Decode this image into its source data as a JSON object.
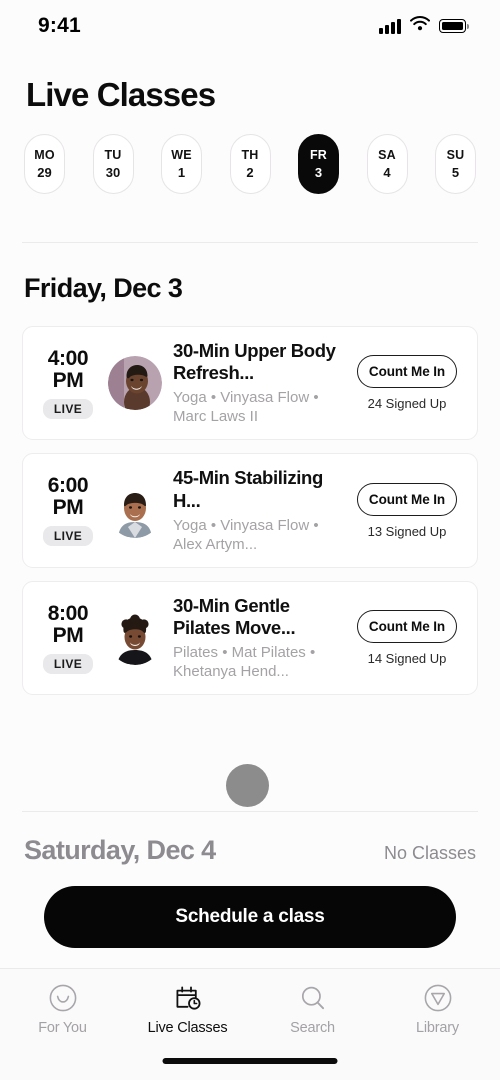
{
  "status_bar": {
    "time": "9:41",
    "icons": [
      "signal-bars-icon",
      "wifi-icon",
      "battery-icon"
    ]
  },
  "header": {
    "title": "Live Classes"
  },
  "day_strip": {
    "days": [
      {
        "dow": "MO",
        "date": "29",
        "selected": false
      },
      {
        "dow": "TU",
        "date": "30",
        "selected": false
      },
      {
        "dow": "WE",
        "date": "1",
        "selected": false
      },
      {
        "dow": "TH",
        "date": "2",
        "selected": false
      },
      {
        "dow": "FR",
        "date": "3",
        "selected": true
      },
      {
        "dow": "SA",
        "date": "4",
        "selected": false
      },
      {
        "dow": "SU",
        "date": "5",
        "selected": false
      }
    ]
  },
  "sections": {
    "today": {
      "title": "Friday, Dec 3",
      "classes": [
        {
          "time": "4:00 PM",
          "badge": "LIVE",
          "title": "30-Min Upper Body Refresh...",
          "meta": "Yoga • Vinyasa Flow • Marc Laws II",
          "action_label": "Count Me In",
          "signed_up": "24 Signed Up",
          "avatar_name": "instructor-avatar-marc-laws"
        },
        {
          "time": "6:00 PM",
          "badge": "LIVE",
          "title": "45-Min Stabilizing H...",
          "meta": "Yoga • Vinyasa Flow • Alex Artym...",
          "action_label": "Count Me In",
          "signed_up": "13 Signed Up",
          "avatar_name": "instructor-avatar-alex-artym"
        },
        {
          "time": "8:00 PM",
          "badge": "LIVE",
          "title": "30-Min Gentle Pilates Move...",
          "meta": "Pilates • Mat Pilates • Khetanya Hend...",
          "action_label": "Count Me In",
          "signed_up": "14 Signed Up",
          "avatar_name": "instructor-avatar-khetanya-henderson"
        }
      ]
    },
    "next_day": {
      "title": "Saturday, Dec 4",
      "status": "No Classes"
    }
  },
  "cta": {
    "label": "Schedule a class"
  },
  "tab_bar": {
    "tabs": [
      {
        "label": "For You",
        "icon": "smiley-face-icon",
        "active": false
      },
      {
        "label": "Live Classes",
        "icon": "calendar-clock-icon",
        "active": true
      },
      {
        "label": "Search",
        "icon": "magnifier-icon",
        "active": false
      },
      {
        "label": "Library",
        "icon": "triangle-circle-icon",
        "active": false
      }
    ]
  },
  "colors": {
    "accent": "#090909",
    "background": "#fdfcfd",
    "card": "#ffffff",
    "muted_text": "#a5a2a6",
    "badge_bg": "#e9e8ea",
    "divider": "#eceaec",
    "cursor": "#8c8c8c"
  }
}
